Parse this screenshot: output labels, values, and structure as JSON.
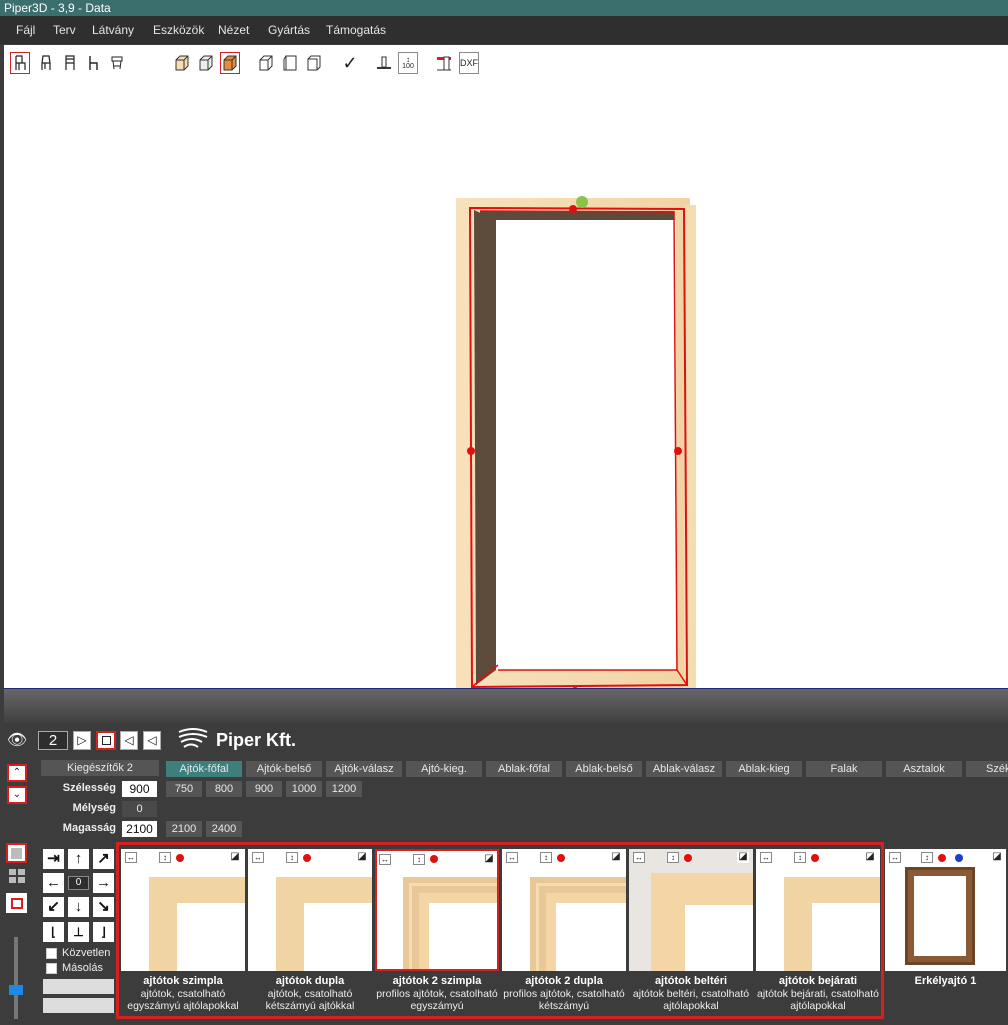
{
  "window": {
    "title": "Piper3D - 3,9 - Data"
  },
  "menu": [
    "Fájl",
    "Terv",
    "Látvány",
    "Eszközök",
    "Nézet",
    "Gyártás",
    "Támogatás"
  ],
  "toolbar": {
    "check_icon": "✓",
    "height_label": "100",
    "dxf_label": "DXF"
  },
  "viewer": {
    "level": "2",
    "company": "Piper Kft."
  },
  "categories": {
    "selected_group": "Kiegészítők 2",
    "tabs": [
      "Ajtók-főfal",
      "Ajtók-belső",
      "Ajtók-válasz",
      "Ajtó-kieg.",
      "Ablak-főfal",
      "Ablak-belső",
      "Ablak-válasz",
      "Ablak-kieg",
      "Falak",
      "Asztalok",
      "Szék"
    ],
    "active_tab": "Ajtók-főfal"
  },
  "dimensions": {
    "width_label": "Szélesség",
    "width_value": "900",
    "width_presets": [
      "750",
      "800",
      "900",
      "1000",
      "1200"
    ],
    "depth_label": "Mélység",
    "depth_value": "0",
    "height_label": "Magasság",
    "height_value": "2100",
    "height_presets": [
      "2100",
      "2400"
    ]
  },
  "nudge": {
    "step_value": "0"
  },
  "options": {
    "direct_label": "Közvetlen",
    "copy_label": "Másolás"
  },
  "catalog": [
    {
      "name": "ajtótok szimpla",
      "desc": "ajtótok, csatolható egyszámyú ajtólapokkal"
    },
    {
      "name": "ajtótok dupla",
      "desc": "ajtótok, csatolható kétszámyú ajtókkal"
    },
    {
      "name": "ajtótok 2 szimpla",
      "desc": "profilos ajtótok, csatolható egyszámyú"
    },
    {
      "name": "ajtótok 2 dupla",
      "desc": "profilos ajtótok, csatolható kétszámyú"
    },
    {
      "name": "ajtótok beltéri",
      "desc": "ajtótok beltéri, csatolható ajtólapokkal"
    },
    {
      "name": "ajtótok bejárati",
      "desc": "ajtótok bejárati, csatolható ajtólapokkal"
    },
    {
      "name": "Erkélyajtó 1",
      "desc": ""
    }
  ],
  "colors": {
    "accent_red": "#d62020",
    "titlebar": "#3b6f6e",
    "active_tab": "#3d7f7c",
    "wood": "#f3d7a8"
  }
}
